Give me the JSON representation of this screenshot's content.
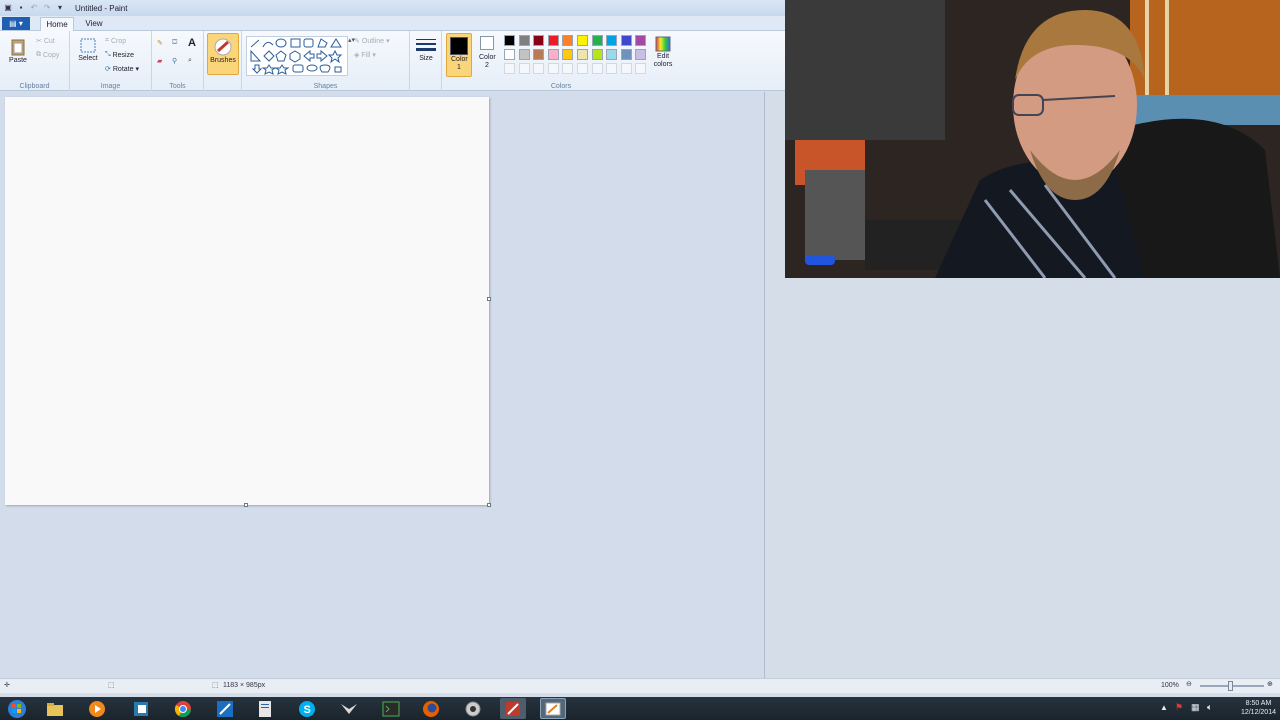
{
  "window": {
    "title": "Untitled - Paint"
  },
  "tabs": [
    "Home",
    "View"
  ],
  "file_button": "",
  "ribbon": {
    "clipboard": {
      "label": "Clipboard",
      "paste": "Paste",
      "cut": "Cut",
      "copy": "Copy"
    },
    "image": {
      "label": "Image",
      "select": "Select",
      "crop": "Crop",
      "resize": "Resize",
      "rotate": "Rotate"
    },
    "tools": {
      "label": "Tools"
    },
    "brushes": {
      "label": "Brushes"
    },
    "shapes": {
      "label": "Shapes",
      "outline": "Outline",
      "fill": "Fill"
    },
    "size": {
      "label": "Size"
    },
    "colors": {
      "label": "Colors",
      "color1": "Color 1",
      "color2": "Color 2",
      "edit_colors": "Edit colors",
      "color1_value": "#000000",
      "color2_value": "#ffffff",
      "palette_row1": [
        "#000000",
        "#7f7f7f",
        "#880015",
        "#ed1c24",
        "#ff7f27",
        "#fff200",
        "#22b14c",
        "#00a2e8",
        "#3f48cc",
        "#a349a4"
      ],
      "palette_row2": [
        "#ffffff",
        "#c3c3c3",
        "#b97a57",
        "#ffaec9",
        "#ffc90e",
        "#efe4b0",
        "#b5e61d",
        "#99d9ea",
        "#7092be",
        "#c8bfe7"
      ]
    }
  },
  "status": {
    "dimensions": "1183 × 985px",
    "zoom": "100%"
  },
  "taskbar": {
    "time": "8:50 AM",
    "date": "12/12/2014"
  }
}
